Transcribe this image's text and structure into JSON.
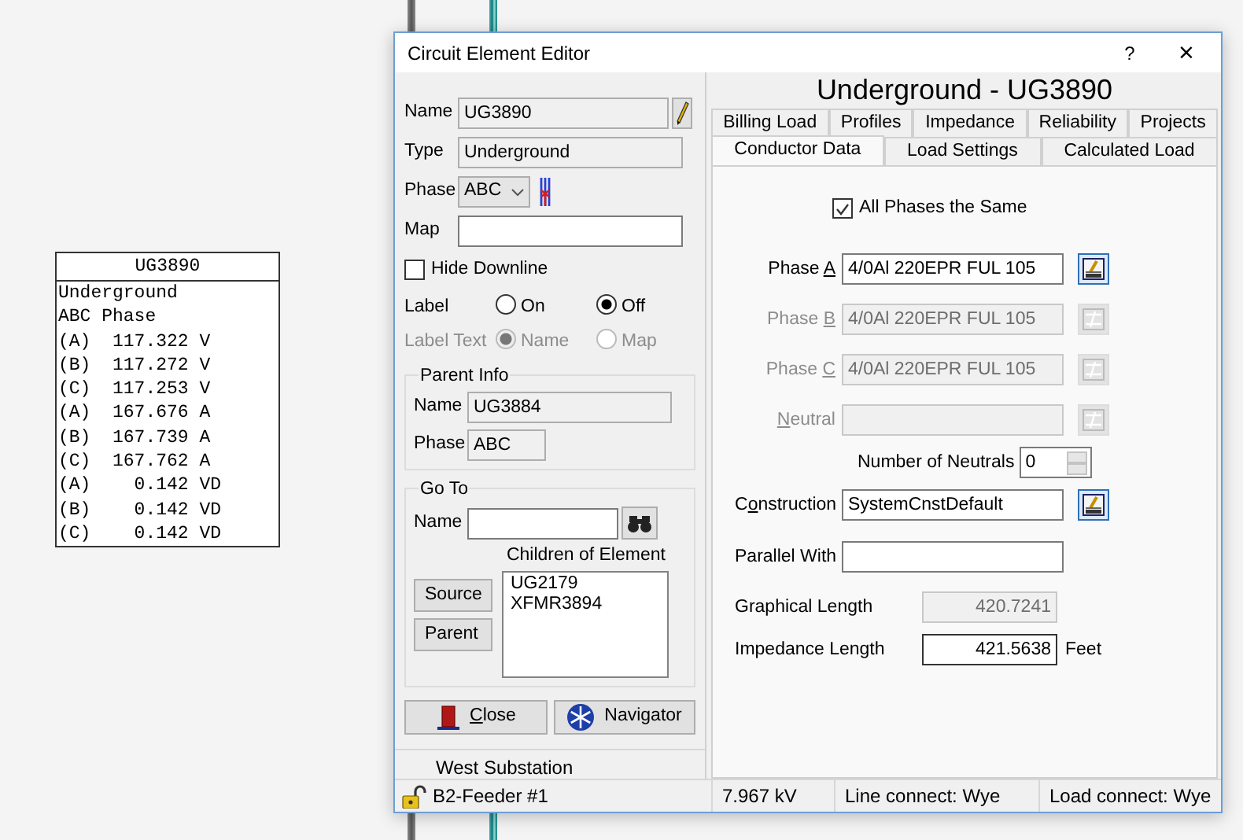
{
  "map_label": {
    "title": "UG3890",
    "lines": [
      "Underground",
      "ABC Phase",
      "(A)  117.322 V",
      "(B)  117.272 V",
      "(C)  117.253 V",
      "(A)  167.676 A",
      "(B)  167.739 A",
      "(C)  167.762 A",
      "(A)    0.142 VD",
      "(B)    0.142 VD",
      "(C)    0.142 VD"
    ]
  },
  "window": {
    "title": "Circuit Element Editor",
    "help": "?",
    "close": "×"
  },
  "element": {
    "fields": [
      {
        "label": "Name",
        "value": "UG3890",
        "kind": "readonly-edit"
      },
      {
        "label": "Type",
        "value": "Underground",
        "kind": "readonly"
      },
      {
        "label": "Phase",
        "value": "ABC",
        "kind": "select"
      },
      {
        "label": "Map",
        "kind": "text"
      }
    ],
    "hide_downline": {
      "label": "Hide Downline",
      "checked": false
    },
    "label_display": {
      "label": "Label",
      "disabled": false,
      "options": [
        {
          "label": "On",
          "selected": false
        },
        {
          "label": "Off",
          "selected": true
        }
      ]
    },
    "label_text": {
      "label": "Label Text",
      "disabled": true,
      "options": [
        {
          "label": "Name",
          "selected": true
        },
        {
          "label": "Map",
          "selected": false
        }
      ]
    },
    "parent_info": {
      "title": "Parent Info",
      "fields": [
        {
          "label": "Name",
          "value": "UG3884"
        },
        {
          "label": "Phase",
          "value": "ABC"
        }
      ]
    },
    "go_to": {
      "title": "Go To",
      "name_label": "Name",
      "children_label": "Children of Element",
      "children": [
        {
          "label": "UG2179",
          "selected": false
        },
        {
          "label": "XFMR3894",
          "selected": false
        }
      ],
      "buttons": [
        "Source",
        "Parent"
      ]
    },
    "buttons": [
      {
        "kind": "close",
        "label": [
          {
            "text": "C",
            "underlined": true
          },
          {
            "text": "lose",
            "underlined": false
          }
        ]
      },
      {
        "kind": "navigator",
        "label": [
          {
            "text": "Navigator",
            "underlined": false
          }
        ]
      }
    ],
    "location": "West Substation"
  },
  "conductor": {
    "heading": "Underground - UG3890",
    "tab_rows": [
      [
        {
          "label": "Billing Load",
          "selected": false
        },
        {
          "label": "Profiles",
          "selected": false
        },
        {
          "label": "Impedance",
          "selected": false
        },
        {
          "label": "Reliability",
          "selected": false
        },
        {
          "label": "Projects",
          "selected": false
        }
      ],
      [
        {
          "label": "Conductor Data",
          "selected": true
        },
        {
          "label": "Load Settings",
          "selected": false
        },
        {
          "label": "Calculated Load",
          "selected": false
        }
      ]
    ],
    "all_phases": {
      "label": "All Phases the Same",
      "checked": true
    },
    "phases": [
      {
        "label": [
          {
            "text": "Phase ",
            "underlined": false
          },
          {
            "text": "A",
            "underlined": true
          }
        ],
        "value": "4/0Al 220EPR FUL 105",
        "disabled": false
      },
      {
        "label": [
          {
            "text": "Phase ",
            "underlined": false
          },
          {
            "text": "B",
            "underlined": true
          }
        ],
        "value": "4/0Al 220EPR FUL 105",
        "disabled": true
      },
      {
        "label": [
          {
            "text": "Phase ",
            "underlined": false
          },
          {
            "text": "C",
            "underlined": true
          }
        ],
        "value": "4/0Al 220EPR FUL 105",
        "disabled": true
      },
      {
        "label": [
          {
            "text": "N",
            "underlined": true
          },
          {
            "text": "eutral",
            "underlined": false
          }
        ],
        "disabled": true
      }
    ],
    "neutral_count": {
      "label": "Number of Neutrals",
      "value": "0"
    },
    "construction": {
      "label": [
        {
          "text": "C",
          "underlined": false
        },
        {
          "text": "o",
          "underlined": true
        },
        {
          "text": "nstruction",
          "underlined": false
        }
      ],
      "value": "SystemCnstDefault"
    },
    "parallel_with": {
      "label": "Parallel With"
    },
    "lengths": [
      {
        "label": "Graphical Length",
        "value": "420.7241",
        "disabled": true
      },
      {
        "label": "Impedance Length",
        "value": "421.5638",
        "unit": "Feet",
        "disabled": false
      }
    ]
  },
  "status_bar": {
    "feeder": "B2-Feeder #1",
    "cells": [
      "7.967 kV",
      "Line connect: Wye",
      "Load connect: Wye"
    ]
  }
}
